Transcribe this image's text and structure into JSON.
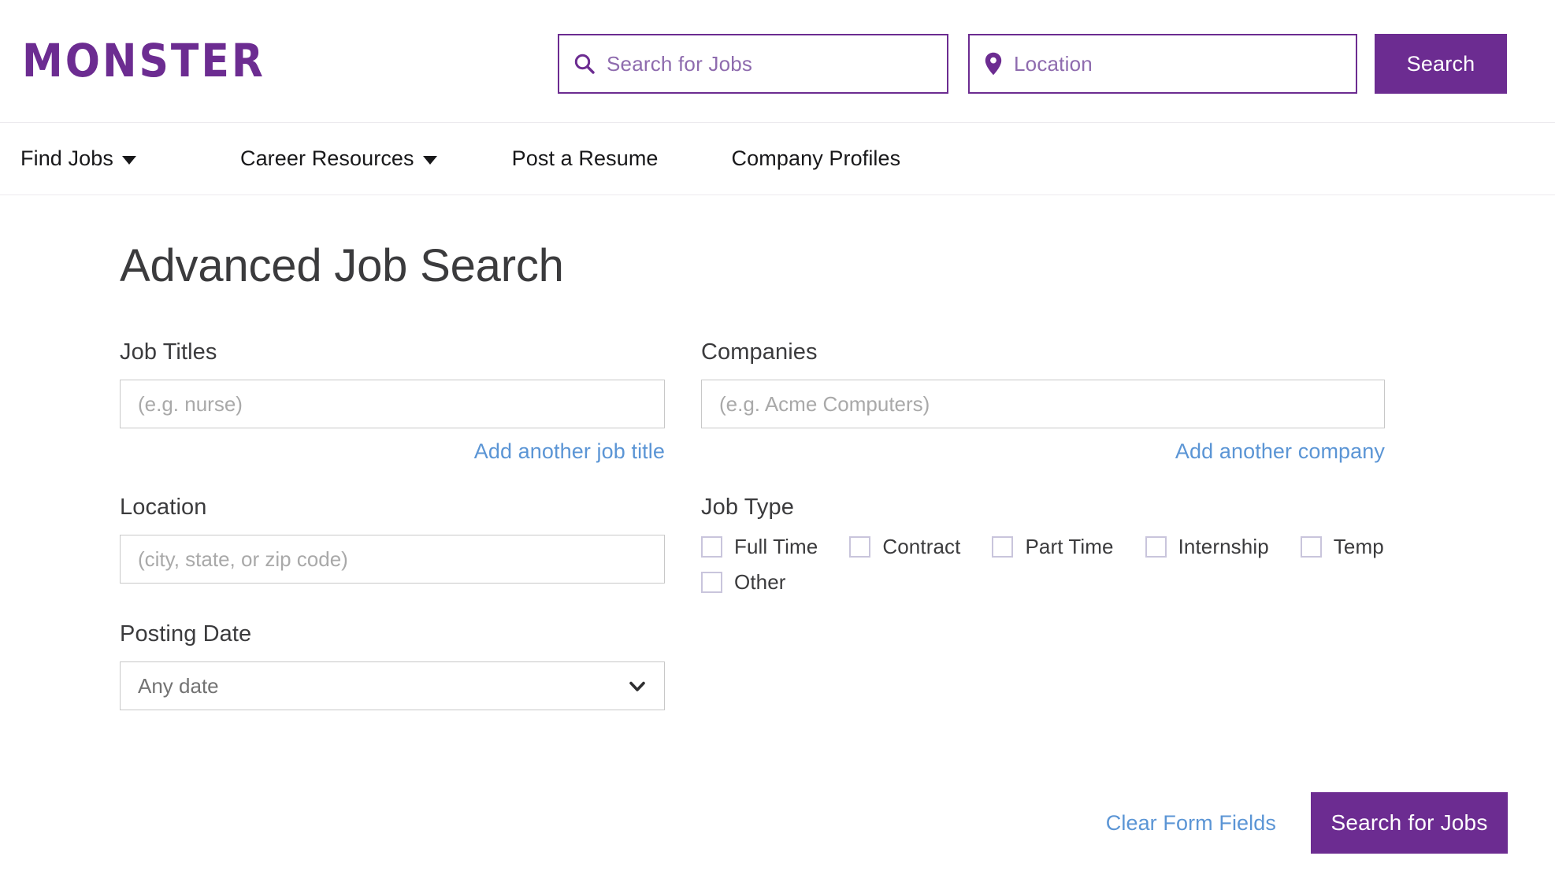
{
  "brand": {
    "logo_text": "MONSTER",
    "purple": "#6C2C91",
    "link_blue": "#5B95D5"
  },
  "header": {
    "job_search": {
      "icon": "search-icon",
      "placeholder": "Search for Jobs",
      "value": ""
    },
    "location_search": {
      "icon": "location-pin-icon",
      "placeholder": "Location",
      "value": ""
    },
    "search_button_label": "Search"
  },
  "nav": {
    "items": [
      {
        "label": "Find Jobs",
        "has_dropdown": true
      },
      {
        "label": "Career Resources",
        "has_dropdown": true
      },
      {
        "label": "Post a Resume",
        "has_dropdown": false
      },
      {
        "label": "Company Profiles",
        "has_dropdown": false
      }
    ]
  },
  "main": {
    "title": "Advanced Job Search",
    "job_titles": {
      "label": "Job Titles",
      "placeholder": "(e.g. nurse)",
      "value": "",
      "add_link": "Add another job title"
    },
    "companies": {
      "label": "Companies",
      "placeholder": "(e.g. Acme Computers)",
      "value": "",
      "add_link": "Add another company"
    },
    "location": {
      "label": "Location",
      "placeholder": "(city, state, or zip code)",
      "value": ""
    },
    "job_type": {
      "label": "Job Type",
      "options": [
        {
          "label": "Full Time",
          "checked": false
        },
        {
          "label": "Contract",
          "checked": false
        },
        {
          "label": "Part Time",
          "checked": false
        },
        {
          "label": "Internship",
          "checked": false
        },
        {
          "label": "Temp",
          "checked": false
        },
        {
          "label": "Other",
          "checked": false
        }
      ]
    },
    "posting_date": {
      "label": "Posting Date",
      "selected": "Any date",
      "icon": "chevron-down-icon"
    }
  },
  "actions": {
    "clear_label": "Clear Form Fields",
    "submit_label": "Search for Jobs"
  }
}
